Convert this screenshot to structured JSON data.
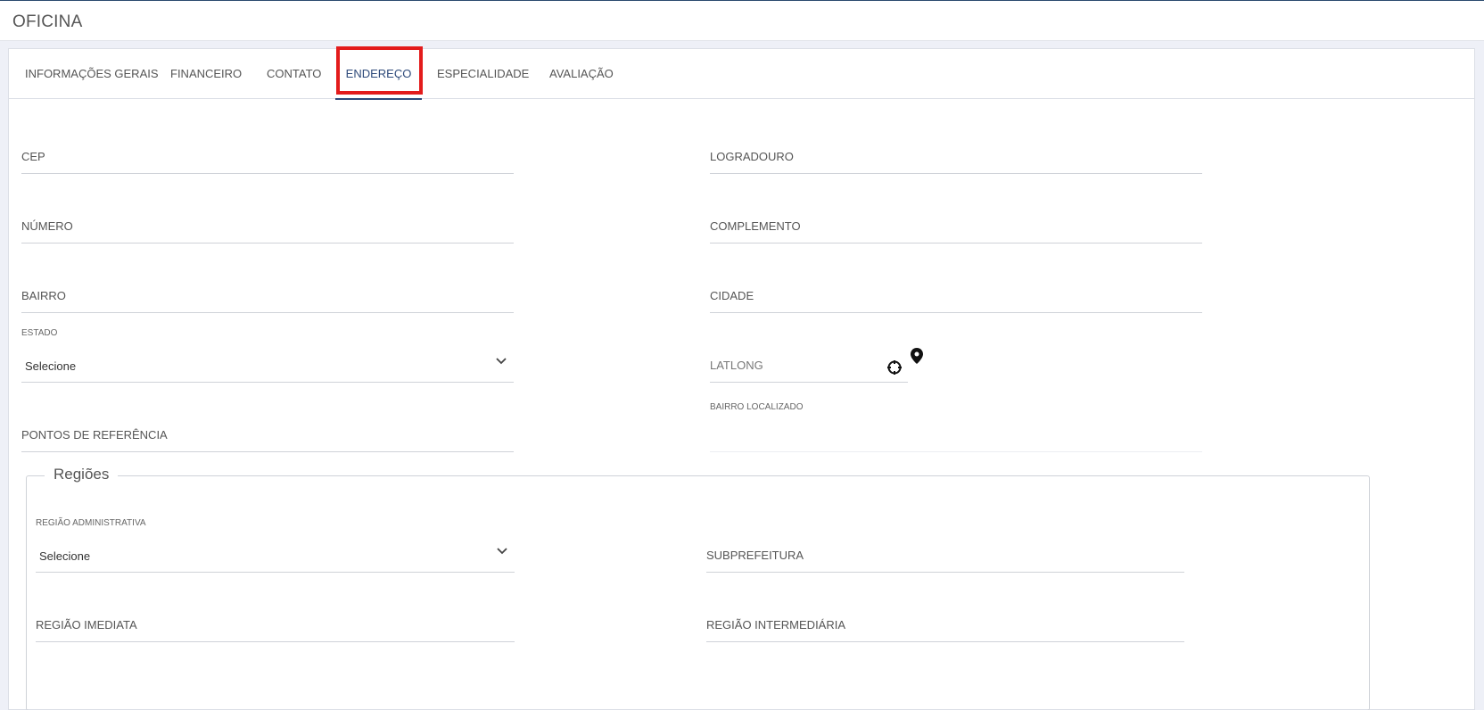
{
  "header": {
    "title": "OFICINA"
  },
  "tabs": [
    {
      "label": "INFORMAÇÕES GERAIS"
    },
    {
      "label": "FINANCEIRO"
    },
    {
      "label": "CONTATO"
    },
    {
      "label": "ENDEREÇO"
    },
    {
      "label": "ESPECIALIDADE"
    },
    {
      "label": "AVALIAÇÃO"
    }
  ],
  "active_tab": "ENDEREÇO",
  "form": {
    "cep": "CEP",
    "logradouro": "LOGRADOURO",
    "numero": "NÚMERO",
    "complemento": "COMPLEMENTO",
    "bairro": "BAIRRO",
    "cidade": "CIDADE",
    "estado_label": "ESTADO",
    "estado_value": "Selecione",
    "latlong": "LATLONG",
    "bairro_localizado_label": "BAIRRO LOCALIZADO",
    "pontos_referencia": "PONTOS DE REFERÊNCIA"
  },
  "regioes": {
    "legend": "Regiões",
    "regiao_admin_label": "REGIÃO ADMINISTRATIVA",
    "regiao_admin_value": "Selecione",
    "subprefeitura": "SUBPREFEITURA",
    "regiao_imediata": "REGIÃO IMEDIATA",
    "regiao_intermediaria": "REGIÃO INTERMEDIÁRIA"
  },
  "icons": {
    "crosshair": "crosshair-icon",
    "map_pin": "map-pin-icon",
    "chevron": "chevron-down-icon"
  },
  "colors": {
    "accent": "#2e4a7a",
    "highlight": "#e31b1b",
    "background": "#eef0f7"
  }
}
